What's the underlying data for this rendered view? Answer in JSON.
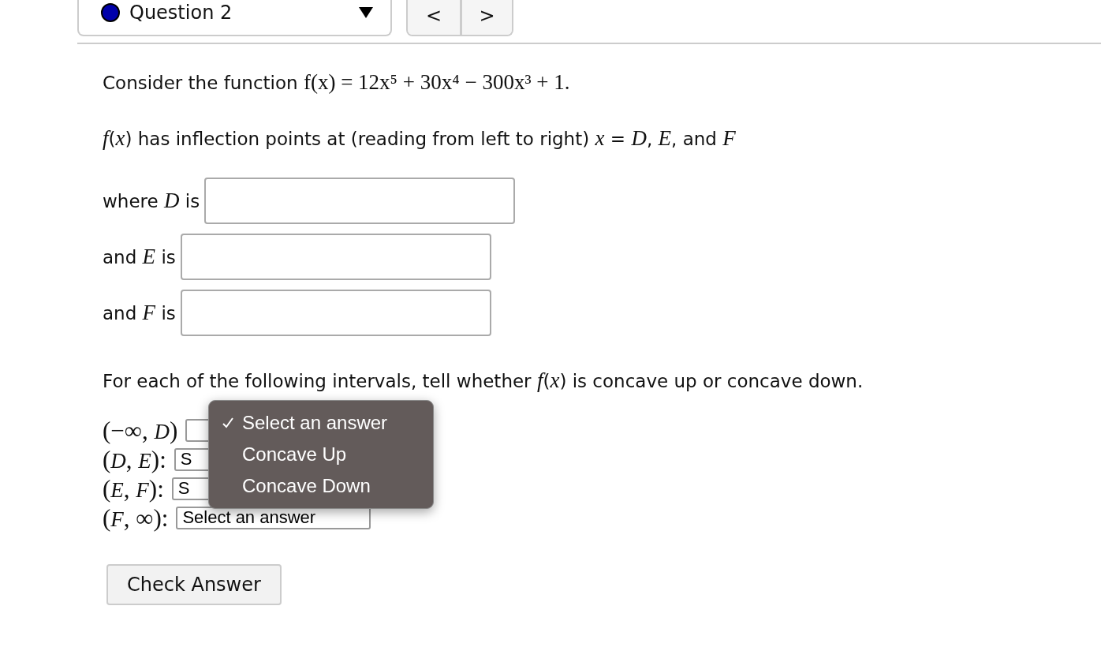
{
  "question_selector": {
    "label": "Question 2"
  },
  "nav": {
    "prev": "<",
    "next": ">"
  },
  "intro": "Consider the function",
  "formula": "f(x) = 12x⁵ + 30x⁴ − 300x³ + 1.",
  "statement": "*f*(*x*) has inflection points at (reading from left to right) *x* = *D*, *E*, and *F*",
  "answers": [
    {
      "label": "where *D* is"
    },
    {
      "label": "and *E* is"
    },
    {
      "label": "and *F* is"
    }
  ],
  "concavity_prompt": "For each of the following intervals, tell whether *f*(*x*) is concave up or concave down.",
  "intervals": [
    {
      "label": "(−∞, *D*)"
    },
    {
      "label": "(*D*, *E*):",
      "select": "S"
    },
    {
      "label": "(*E*, *F*):",
      "select": "S"
    },
    {
      "label": "(*F*, ∞):",
      "select": "Select an answer"
    }
  ],
  "dropdown_menu": [
    {
      "label": "Select an answer",
      "selected": true
    },
    {
      "label": "Concave Up",
      "selected": false
    },
    {
      "label": "Concave Down",
      "selected": false
    }
  ],
  "check_button": "Check Answer"
}
